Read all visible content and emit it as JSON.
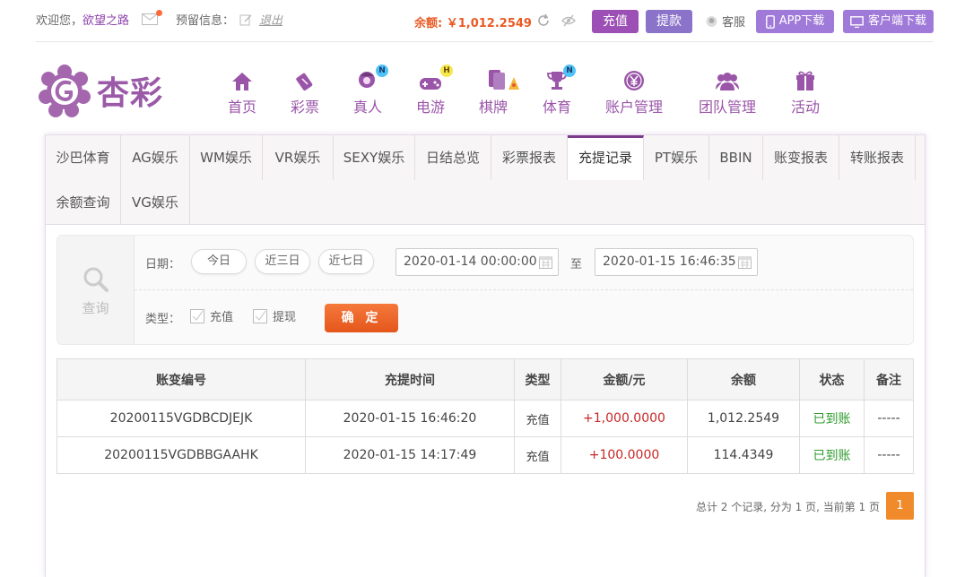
{
  "topbar": {
    "welcome": "欢迎您，",
    "username": "欲望之路",
    "reserve_label": "预留信息：",
    "logout": "退出",
    "balance": "余额: ￥1,012.2549",
    "deposit": "充值",
    "withdraw": "提款",
    "service": "客服",
    "app_download": "APP下载",
    "client_download": "客户端下载"
  },
  "brand": {
    "name": "杏彩"
  },
  "nav": [
    {
      "label": "首页",
      "icon": "home-icon"
    },
    {
      "label": "彩票",
      "icon": "lottery-ticket-icon"
    },
    {
      "label": "真人",
      "icon": "live-dealer-icon",
      "badge": "N"
    },
    {
      "label": "电游",
      "icon": "gamepad-icon",
      "badge": "H"
    },
    {
      "label": "棋牌",
      "icon": "cards-icon"
    },
    {
      "label": "体育",
      "icon": "trophy-icon",
      "badge": "N"
    },
    {
      "label": "账户管理",
      "icon": "account-icon"
    },
    {
      "label": "团队管理",
      "icon": "team-icon"
    },
    {
      "label": "活动",
      "icon": "gift-icon"
    }
  ],
  "tabs": [
    "沙巴体育",
    "AG娱乐",
    "WM娱乐",
    "VR娱乐",
    "SEXY娱乐",
    "日结总览",
    "彩票报表",
    "充提记录",
    "PT娱乐",
    "BBIN",
    "账变报表",
    "转账报表",
    "余额查询",
    "VG娱乐"
  ],
  "search": {
    "side_label": "查询",
    "date_label": "日期：",
    "quick_dates": [
      "今日",
      "近三日",
      "近七日"
    ],
    "start": "2020-01-14 00:00:00",
    "to": "至",
    "end": "2020-01-15 16:46:35",
    "type_label": "类型：",
    "types": [
      "充值",
      "提现"
    ],
    "confirm": "确 定"
  },
  "table": {
    "headers": [
      "账变编号",
      "充提时间",
      "类型",
      "金额/元",
      "余额",
      "状态",
      "备注"
    ],
    "rows": [
      {
        "id": "20200115VGDBCDJEJK",
        "time": "2020-01-15 16:46:20",
        "type": "充值",
        "amount": "+1,000.0000",
        "balance": "1,012.2549",
        "status": "已到账",
        "remark": "-----"
      },
      {
        "id": "20200115VGDBBGAAHK",
        "time": "2020-01-15 14:17:49",
        "type": "充值",
        "amount": "+100.0000",
        "balance": "114.4349",
        "status": "已到账",
        "remark": "-----"
      }
    ]
  },
  "pager": {
    "summary": "总计 2 个记录, 分为 1 页, 当前第 1 页",
    "current": "1"
  },
  "colors": {
    "brand_purple": "#9a55a8",
    "accent_orange": "#e85a24",
    "tab_active": "#7d3b8c"
  }
}
